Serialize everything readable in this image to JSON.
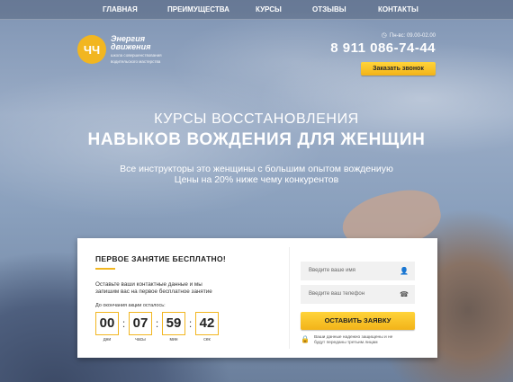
{
  "nav": {
    "items": [
      "ГЛАВНАЯ",
      "ПРЕИМУЩЕСТВА",
      "КУРСЫ",
      "ОТЗЫВЫ",
      "КОНТАКТЫ"
    ]
  },
  "logo": {
    "monogram": "ЧЧ",
    "name_line1": "Энергия",
    "name_line2": "движения",
    "subtitle_line1": "школа совершенствования",
    "subtitle_line2": "водительского мастерства"
  },
  "contact": {
    "hours": "Пн-вс: 09.00-02.00",
    "phone": "8 911 086-74-44",
    "call_button": "Заказать звонок"
  },
  "hero": {
    "title_top": "КУРСЫ ВОССТАНОВЛЕНИЯ",
    "title_main": "НАВЫКОВ ВОЖДЕНИЯ ДЛЯ ЖЕНЩИН",
    "subtitle_line1": "Все инструкторы это женщины с большим опытом вождениую",
    "subtitle_line2": "Цены на 20% ниже чему конкурентов"
  },
  "offer": {
    "title": "ПЕРВОЕ ЗАНЯТИЕ БЕСПЛАТНО!",
    "desc_line1": "Оставьте ваши контактные данные и мы",
    "desc_line2": "запишим вас на первое бесплатное занятие",
    "countdown_label": "До окончания акции осталось:",
    "countdown": [
      {
        "value": "00",
        "label": "дни"
      },
      {
        "value": "07",
        "label": "часы"
      },
      {
        "value": "59",
        "label": "мин"
      },
      {
        "value": "42",
        "label": "сек"
      }
    ]
  },
  "form": {
    "name_placeholder": "Введите ваше имя",
    "phone_placeholder": "Введите ваш телефон",
    "submit": "ОСТАВИТЬ ЗАЯВКУ",
    "privacy_line1": "Ваши данные надежно защищены и не",
    "privacy_line2": "будут переданы третьим лицам"
  },
  "colors": {
    "accent": "#f2b620",
    "text_dark": "#222222"
  }
}
